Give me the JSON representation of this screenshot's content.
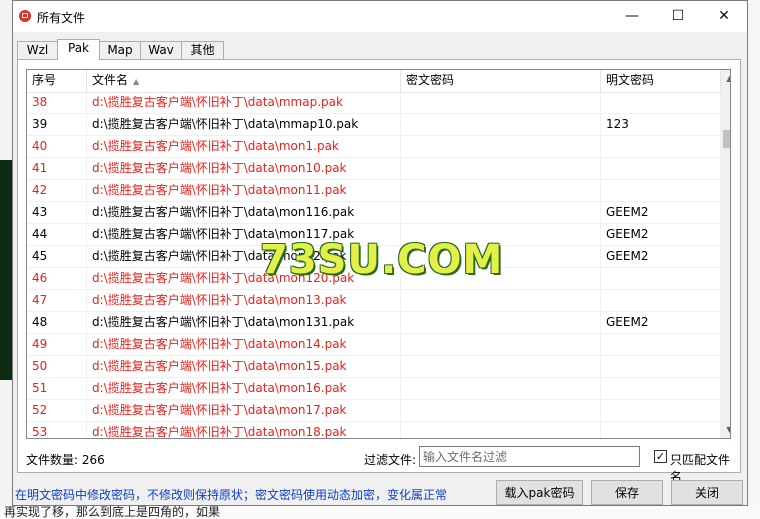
{
  "window": {
    "title": "所有文件",
    "minimize": "—",
    "maximize": "☐",
    "close": "✕"
  },
  "tabs": [
    {
      "label": "Wzl",
      "active": false
    },
    {
      "label": "Pak",
      "active": true
    },
    {
      "label": "Map",
      "active": false
    },
    {
      "label": "Wav",
      "active": false
    },
    {
      "label": "其他",
      "active": false
    }
  ],
  "table": {
    "columns": [
      "序号",
      "文件名",
      "密文密码",
      "明文密码"
    ],
    "rows": [
      {
        "no": "38",
        "file": "d:\\揽胜复古客户端\\怀旧补丁\\data\\mmap.pak",
        "cipher": "",
        "plain": "",
        "red": true
      },
      {
        "no": "39",
        "file": "d:\\揽胜复古客户端\\怀旧补丁\\data\\mmap10.pak",
        "cipher": "",
        "plain": "123",
        "red": false
      },
      {
        "no": "40",
        "file": "d:\\揽胜复古客户端\\怀旧补丁\\data\\mon1.pak",
        "cipher": "",
        "plain": "",
        "red": true
      },
      {
        "no": "41",
        "file": "d:\\揽胜复古客户端\\怀旧补丁\\data\\mon10.pak",
        "cipher": "",
        "plain": "",
        "red": true
      },
      {
        "no": "42",
        "file": "d:\\揽胜复古客户端\\怀旧补丁\\data\\mon11.pak",
        "cipher": "",
        "plain": "",
        "red": true
      },
      {
        "no": "43",
        "file": "d:\\揽胜复古客户端\\怀旧补丁\\data\\mon116.pak",
        "cipher": "",
        "plain": "GEEM2",
        "red": false
      },
      {
        "no": "44",
        "file": "d:\\揽胜复古客户端\\怀旧补丁\\data\\mon117.pak",
        "cipher": "",
        "plain": "GEEM2",
        "red": false
      },
      {
        "no": "45",
        "file": "d:\\揽胜复古客户端\\怀旧补丁\\data\\mon12.pak",
        "cipher": "",
        "plain": "GEEM2",
        "red": false
      },
      {
        "no": "46",
        "file": "d:\\揽胜复古客户端\\怀旧补丁\\data\\mon120.pak",
        "cipher": "",
        "plain": "",
        "red": true
      },
      {
        "no": "47",
        "file": "d:\\揽胜复古客户端\\怀旧补丁\\data\\mon13.pak",
        "cipher": "",
        "plain": "",
        "red": true
      },
      {
        "no": "48",
        "file": "d:\\揽胜复古客户端\\怀旧补丁\\data\\mon131.pak",
        "cipher": "",
        "plain": "GEEM2",
        "red": false
      },
      {
        "no": "49",
        "file": "d:\\揽胜复古客户端\\怀旧补丁\\data\\mon14.pak",
        "cipher": "",
        "plain": "",
        "red": true
      },
      {
        "no": "50",
        "file": "d:\\揽胜复古客户端\\怀旧补丁\\data\\mon15.pak",
        "cipher": "",
        "plain": "",
        "red": true
      },
      {
        "no": "51",
        "file": "d:\\揽胜复古客户端\\怀旧补丁\\data\\mon16.pak",
        "cipher": "",
        "plain": "",
        "red": true
      },
      {
        "no": "52",
        "file": "d:\\揽胜复古客户端\\怀旧补丁\\data\\mon17.pak",
        "cipher": "",
        "plain": "",
        "red": true
      },
      {
        "no": "53",
        "file": "d:\\揽胜复古客户端\\怀旧补丁\\data\\mon18.pak",
        "cipher": "",
        "plain": "",
        "red": true
      }
    ]
  },
  "footer": {
    "file_count": "文件数量: 266",
    "filter_label": "过滤文件:",
    "filter_placeholder": "输入文件名过滤",
    "filter_value": "",
    "match_only_label": "只匹配文件名",
    "match_only_checked": "✓",
    "hint": "在明文密码中修改密码，不修改则保持原状；密文密码使用动态加密，变化属正常",
    "load_button": "载入pak密码",
    "save_button": "保存",
    "close_button": "关闭"
  },
  "watermark": "73SU.COM",
  "background_text": {
    "bottom": "再实现了移，那么到底上是四角的，如果"
  },
  "colors": {
    "red_row": "#e8211d",
    "hint": "#0a3fc9"
  }
}
